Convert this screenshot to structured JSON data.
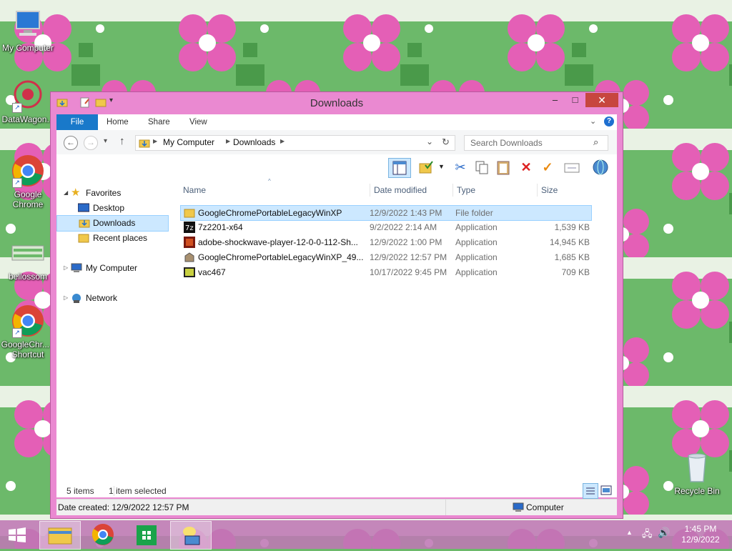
{
  "desktop": {
    "icons": [
      {
        "label": "My Computer"
      },
      {
        "label": "DataWagon..."
      },
      {
        "label": "Google Chrome"
      },
      {
        "label": "bellossom"
      },
      {
        "label": "GoogleChr... - Shortcut"
      },
      {
        "label": "Recycle Bin"
      }
    ]
  },
  "window": {
    "title": "Downloads",
    "tabs": [
      "File",
      "Home",
      "Share",
      "View"
    ],
    "address": {
      "crumbs": [
        "My Computer",
        "Downloads"
      ]
    },
    "search": {
      "placeholder": "Search Downloads"
    },
    "nav": {
      "favorites": "Favorites",
      "desktop": "Desktop",
      "downloads": "Downloads",
      "recent": "Recent places",
      "computer": "My Computer",
      "network": "Network"
    },
    "columns": {
      "name": "Name",
      "date": "Date modified",
      "type": "Type",
      "size": "Size"
    },
    "files": [
      {
        "name": "GoogleChromePortableLegacyWinXP",
        "date": "12/9/2022 1:43 PM",
        "type": "File folder",
        "size": ""
      },
      {
        "name": "7z2201-x64",
        "date": "9/2/2022 2:14 AM",
        "type": "Application",
        "size": "1,539 KB"
      },
      {
        "name": "adobe-shockwave-player-12-0-0-112-Sh...",
        "date": "12/9/2022 1:00 PM",
        "type": "Application",
        "size": "14,945 KB"
      },
      {
        "name": "GoogleChromePortableLegacyWinXP_49....",
        "date": "12/9/2022 12:57 PM",
        "type": "Application",
        "size": "1,685 KB"
      },
      {
        "name": "vac467",
        "date": "10/17/2022 9:45 PM",
        "type": "Application",
        "size": "709 KB"
      }
    ],
    "status": {
      "items": "5 items",
      "selected": "1 item selected"
    },
    "details": {
      "date_created": "Date created: 12/9/2022 12:57 PM",
      "location": "Computer"
    }
  },
  "taskbar": {
    "time": "1:45 PM",
    "date": "12/9/2022"
  },
  "colors": {
    "window_frame": "#ea89d1",
    "file_tab": "#1979ca",
    "selection": "#cce8ff",
    "close_button": "#c7463f"
  }
}
